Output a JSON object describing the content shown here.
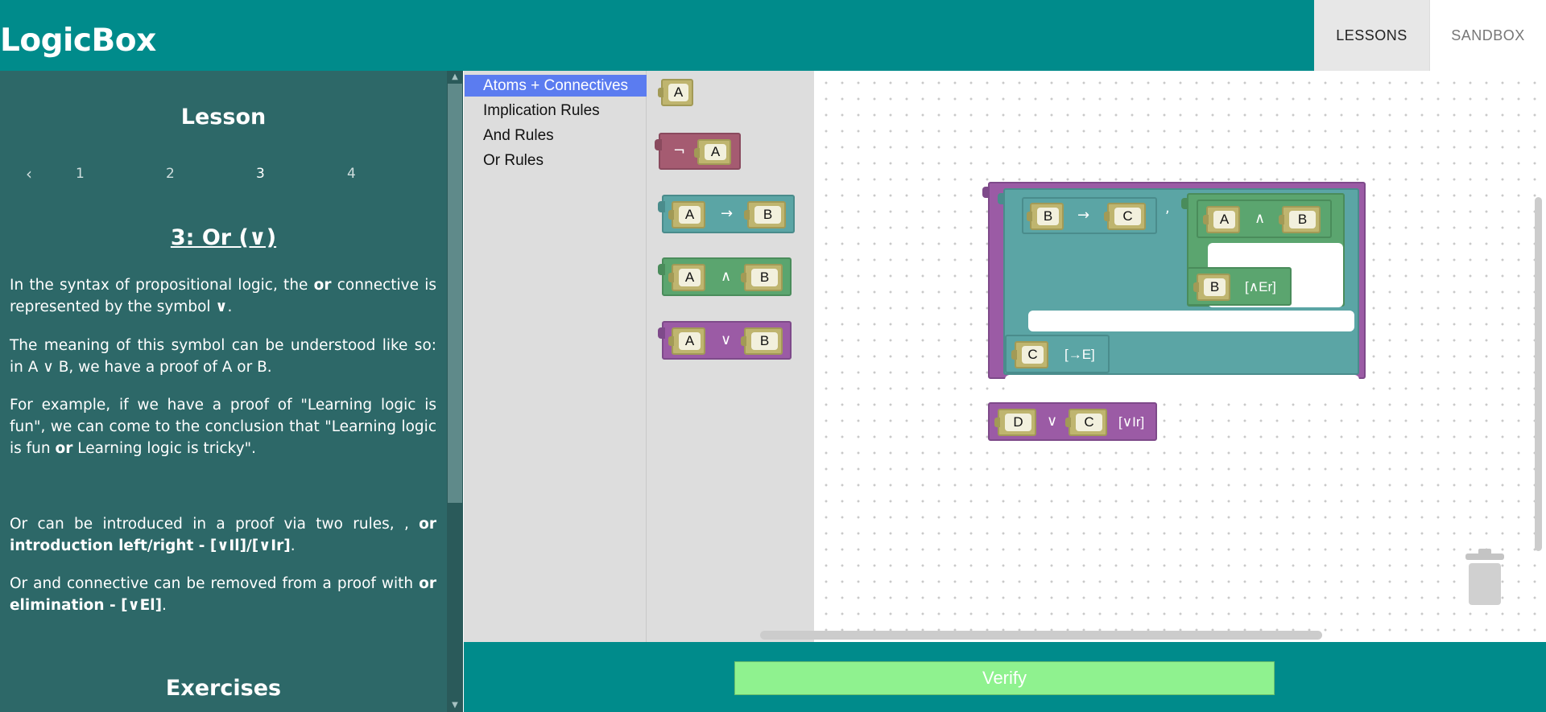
{
  "app": {
    "title": "LogicBox"
  },
  "nav": {
    "lessons": "LESSONS",
    "sandbox": "SANDBOX"
  },
  "lesson": {
    "heading": "Lesson",
    "pager": {
      "prev_symbol": "‹",
      "pages": [
        "1",
        "2",
        "3",
        "4"
      ],
      "current": "3"
    },
    "title": "3: Or (∨)",
    "paragraphs": {
      "p1": {
        "a": "In the syntax of propositional logic, the ",
        "b": "or",
        "c": " connective is represented by the symbol ",
        "d": "∨",
        "e": "."
      },
      "p2": "The meaning of this symbol can be understood like so: in A ∨ B, we have a proof of A or B.",
      "p3": {
        "a": "For example, if we have a proof of \"Learning logic is fun\", we can come to the conclusion that \"Learning logic is fun ",
        "b": "or",
        "c": " Learning logic is tricky\"."
      },
      "p4": {
        "a": "Or can be introduced in a proof via two rules, , ",
        "b": "or introduction left/right - [∨Il]/[∨Ir]",
        "c": "."
      },
      "p5": {
        "a": "Or and connective can be removed from a proof with ",
        "b": "or elimination - [∨El]",
        "c": "."
      }
    },
    "exercises_heading": "Exercises"
  },
  "toolbox": {
    "categories": [
      "Atoms + Connectives",
      "Implication Rules",
      "And Rules",
      "Or Rules"
    ],
    "selected": "Atoms + Connectives",
    "flyout": {
      "atom": "A",
      "negation": {
        "symbol": "¬",
        "operand": "A"
      },
      "implication": {
        "left": "A",
        "symbol": "→",
        "right": "B"
      },
      "conjunction": {
        "left": "A",
        "symbol": "∧",
        "right": "B"
      },
      "disjunction": {
        "left": "A",
        "symbol": "∨",
        "right": "B"
      }
    }
  },
  "workspace": {
    "implication_left": "B",
    "implication_symbol": "→",
    "implication_right": "C",
    "comma": ",",
    "conjunction_left": "A",
    "conjunction_symbol": "∧",
    "conjunction_right": "B",
    "and_elim_atom": "B",
    "and_elim_rule": "[∧Er]",
    "imp_elim_atom": "C",
    "imp_elim_rule": "[→E]",
    "or_left": "D",
    "or_symbol": "∨",
    "or_right": "C",
    "or_rule": "[∨Ir]"
  },
  "colors": {
    "header": "#008b8b",
    "lesson_panel": "#2d6868",
    "negation": "#a55b71",
    "implication": "#5ba5a5",
    "conjunction": "#5ba56f",
    "disjunction": "#9b5ba5",
    "atom": "#bfb56f",
    "verify": "#8ff28f"
  },
  "verify_label": "Verify"
}
